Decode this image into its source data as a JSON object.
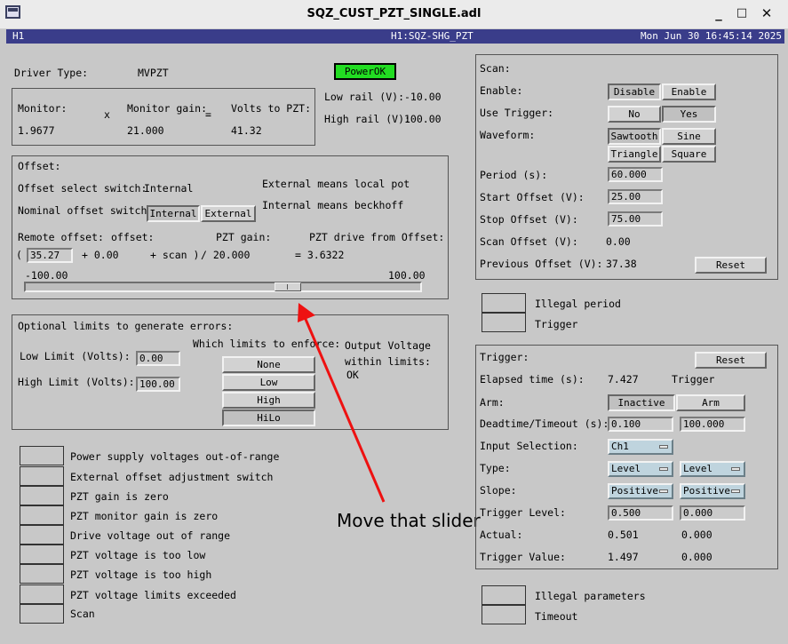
{
  "window": {
    "title": "SQZ_CUST_PZT_SINGLE.adl",
    "minimize": "_",
    "maximize": "□",
    "close": "✕"
  },
  "info": {
    "ifo": "H1",
    "channel": "H1:SQZ-SHG_PZT",
    "datetime": "Mon Jun 30 16:45:14 2025"
  },
  "driver": {
    "type_label": "Driver Type:",
    "type_value": "MVPZT",
    "power_status": "PowerOK",
    "low_rail_label": "Low rail (V):",
    "low_rail_value": "-10.00",
    "high_rail_label": "High rail (V):",
    "high_rail_value": "100.00"
  },
  "monitor": {
    "monitor_label": "Monitor:",
    "times": "x",
    "gain_label": "Monitor gain:",
    "equals": "=",
    "volts_label": "Volts to PZT:",
    "monitor_value": "1.9677",
    "gain_value": "21.000",
    "volts_value": "41.32"
  },
  "offset": {
    "title": "Offset:",
    "select_label": "Offset select switch:",
    "select_value": "Internal",
    "note1": "External means local pot",
    "note2": "Internal means beckhoff",
    "nominal_label": "Nominal offset switch:",
    "btn_internal": "Internal",
    "btn_external": "External",
    "remote_label": "Remote offset:",
    "offset_label": "offset:",
    "gain_label": "PZT gain:",
    "drive_label": "PZT drive from Offset:",
    "paren_open": "(",
    "remote_value": "35.27",
    "plus_offset": "+ 0.00",
    "plus_scan": "+ scan )",
    "div_gain": "/ 20.000",
    "eq_drive": "= 3.6322",
    "slider_min": "-100.00",
    "slider_max": "100.00",
    "slider_value": 35.27
  },
  "limits": {
    "title": "Optional limits to generate errors:",
    "enforce_label": "Which limits to enforce:",
    "output_label1": "Output Voltage",
    "output_label2": "within limits:",
    "output_status": "OK",
    "low_label": "Low Limit (Volts):",
    "low_value": "0.00",
    "high_label": "High Limit (Volts):",
    "high_value": "100.00",
    "options": [
      "None",
      "Low",
      "High",
      "HiLo"
    ]
  },
  "errors": [
    "Power supply voltages out-of-range",
    "External offset adjustment switch",
    "PZT gain is zero",
    "PZT monitor gain is zero",
    "Drive voltage out of range",
    "PZT voltage is too low",
    "PZT voltage is too high",
    "PZT voltage limits exceeded",
    "Scan"
  ],
  "annotation": {
    "text": "Move that slider",
    "color": "#ee1111"
  },
  "scan": {
    "title": "Scan:",
    "enable_label": "Enable:",
    "disable_btn": "Disable",
    "enable_btn": "Enable",
    "trigger_label": "Use Trigger:",
    "no_btn": "No",
    "yes_btn": "Yes",
    "waveform_label": "Waveform:",
    "sawtooth": "Sawtooth",
    "sine": "Sine",
    "triangle": "Triangle",
    "square": "Square",
    "period_label": "Period (s):",
    "period_value": "60.000",
    "start_label": "Start Offset (V):",
    "start_value": "25.00",
    "stop_label": "Stop Offset (V):",
    "stop_value": "75.00",
    "scan_offset_label": "Scan Offset (V):",
    "scan_offset_value": "0.00",
    "prev_label": "Previous Offset (V):",
    "prev_value": "37.38",
    "reset": "Reset"
  },
  "scan_status": {
    "illegal_period": "Illegal period",
    "trigger": "Trigger"
  },
  "trigger": {
    "title": "Trigger:",
    "reset": "Reset",
    "elapsed_label": "Elapsed time (s):",
    "elapsed_value": "7.427",
    "elapsed_state": "Trigger",
    "arm_label": "Arm:",
    "inactive_btn": "Inactive",
    "arm_btn": "Arm",
    "deadtime_label": "Deadtime/Timeout (s):",
    "deadtime_value": "0.100",
    "timeout_value": "100.000",
    "input_label": "Input Selection:",
    "input_value": "Ch1",
    "type_label": "Type:",
    "type_value1": "Level",
    "type_value2": "Level",
    "slope_label": "Slope:",
    "slope_value1": "Positive",
    "slope_value2": "Positive",
    "level_label": "Trigger Level:",
    "level_value1": "0.500",
    "level_value2": "0.000",
    "actual_label": "Actual:",
    "actual_value1": "0.501",
    "actual_value2": "0.000",
    "tvalue_label": "Trigger Value:",
    "tvalue_value1": "1.497",
    "tvalue_value2": "0.000"
  },
  "trigger_status": {
    "illegal_params": "Illegal parameters",
    "timeout": "Timeout"
  }
}
